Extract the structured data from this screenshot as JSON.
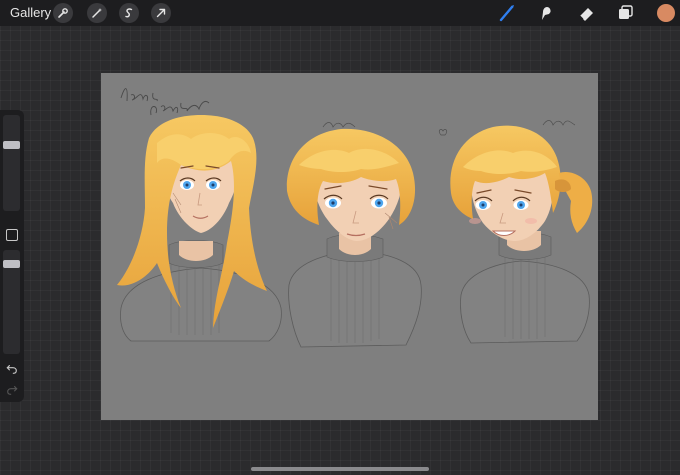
{
  "topbar": {
    "gallery_label": "Gallery",
    "left_tools": [
      "wrench-icon",
      "magic-wand-icon",
      "selection-icon",
      "transform-arrow-icon"
    ],
    "right_tools": [
      "brush-icon",
      "smudge-icon",
      "eraser-icon",
      "layers-icon"
    ],
    "active_tool": "brush-icon",
    "accent_color": "#2f7ff0",
    "current_color": "#d88a62"
  },
  "sidebar": {
    "brush_size_level": 0.7,
    "opacity_level": 0.9,
    "buttons": [
      "modify-button",
      "undo-icon",
      "redo-icon"
    ]
  },
  "canvas": {
    "background_color": "#7f7f7f",
    "hair_color": "#f2b54a"
  }
}
